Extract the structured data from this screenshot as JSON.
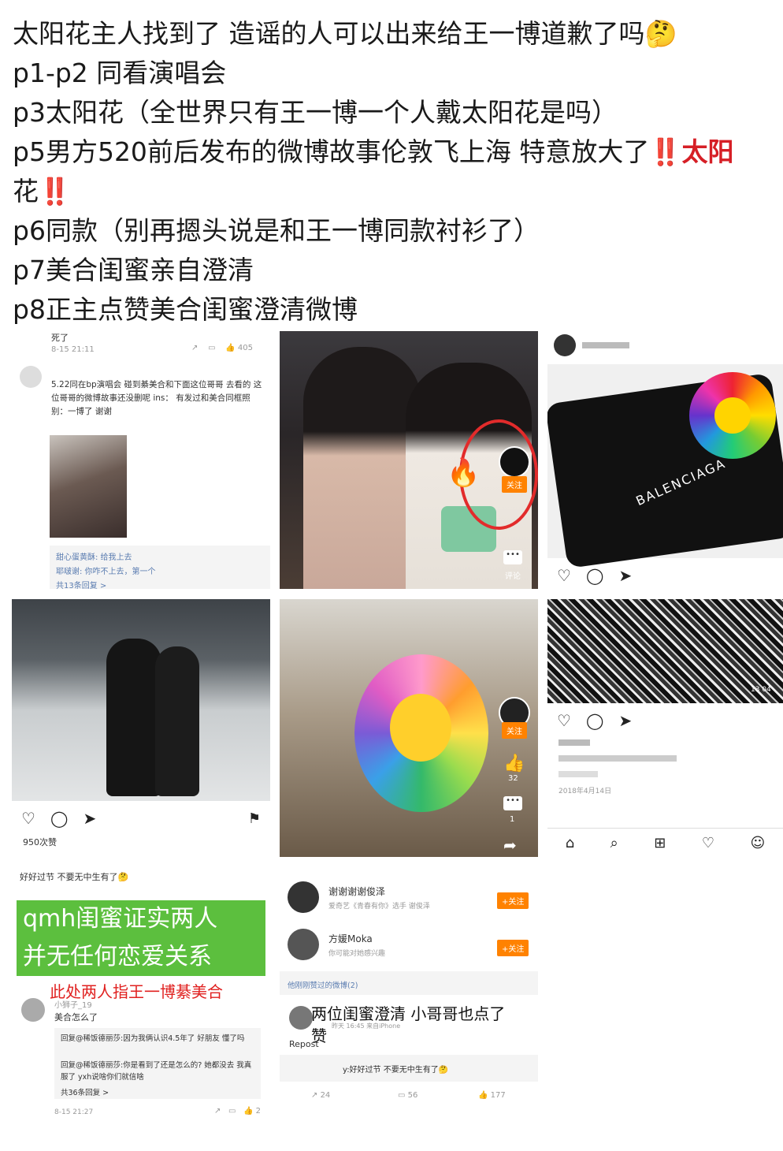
{
  "post": {
    "lines": [
      "太阳花主人找到了 造谣的人可以出来给王一博道歉了吗🤔",
      "p1-p2 同看演唱会",
      "p3太阳花（全世界只有王一博一个人戴太阳花是吗）",
      "p5男方520前后发布的微博故事伦敦飞上海 特意放大了",
      "‼️太阳",
      "花‼️",
      "p6同款（别再摁头说是和王一博同款衬衫了）",
      "p7美合闺蜜亲自澄清",
      "p8正主点赞美合闺蜜澄清微博"
    ]
  },
  "p1": {
    "top_text": "死了",
    "meta": "8-15 21:11",
    "like_count": "405",
    "content": "5.22同在bp演唱会 碰到綦美合和下面这位哥哥 去看的 这位哥哥的微博故事还没删呢 ins： 有发过和美合同框照 别：一博了 谢谢",
    "reply1": "甜心蛋黄酥: 给我上去",
    "reply2": "耶啵谢: 你咋不上去，第一个",
    "more": "共13条回复 >"
  },
  "p2": {
    "follow": "关注",
    "comment": "评论"
  },
  "p3": {
    "brand": "BALENCIAGA"
  },
  "p4": {
    "likes": "950次赞",
    "caption": "好好过节 不要无中生有了🤔"
  },
  "p5": {
    "follow": "关注",
    "count1": "32",
    "count2": "1"
  },
  "p6": {
    "date": "2018年4月14日",
    "timestamp": "13 04"
  },
  "p7": {
    "overlay1": "qmh闺蜜证实两人",
    "overlay2": "并无任何恋爱关系",
    "red_note": "此处两人指王一博綦美合",
    "user": "小狮子_19",
    "question": "美合怎么了",
    "reply1": "回复@稀饭德丽莎:因为我俩认识4.5年了 好朋友 懂了吗",
    "reply2": "回复@稀饭德丽莎:你是看到了还是怎么的? 她都没去 我真服了 yxh说啥你们就信啥",
    "more": "共36条回复 >",
    "meta": "8-15 21:27",
    "likes": "2"
  },
  "p8": {
    "user1": "谢谢谢谢俊泽",
    "user1_sub": "爱奇艺《青春有你》选手 谢俊泽",
    "user2": "方媛Moka",
    "user2_sub": "你可能对她感兴趣",
    "follow": "+关注",
    "section": "他刚刚赞过的微博(2)",
    "overlay1": "两位闺蜜澄清 小哥哥也点了",
    "overlay2": "赞",
    "meta": "昨天 16:45 来自iPhone",
    "repost": "Repost",
    "quote": "y:好好过节 不要无中生有了🤔",
    "reposts": "24",
    "comments": "56",
    "likes": "177"
  }
}
